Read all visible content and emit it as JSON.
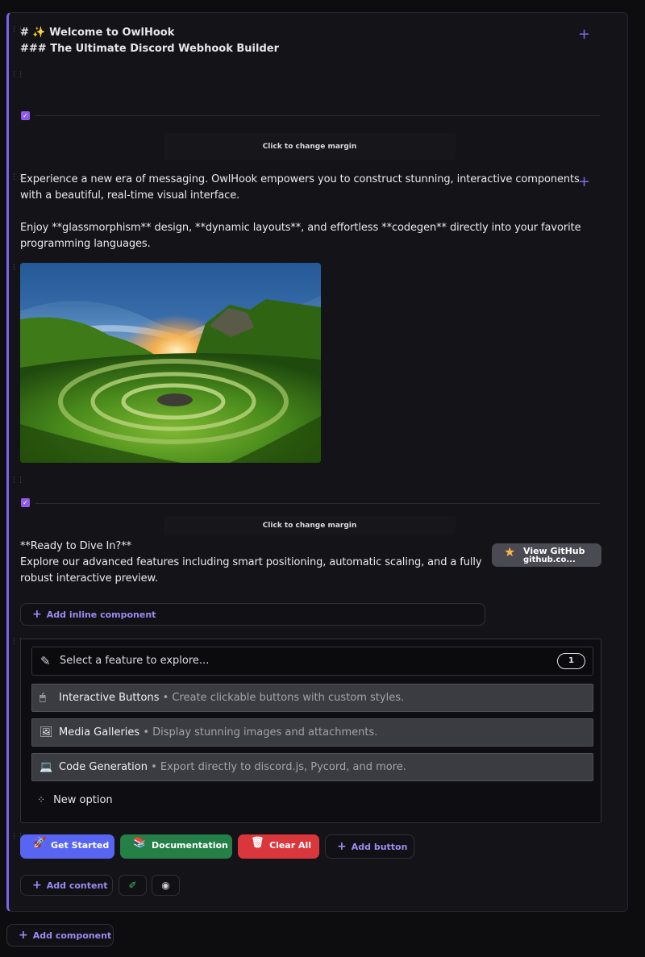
{
  "header": {
    "title": "# ✨ Welcome to OwlHook",
    "subtitle": "### The Ultimate Discord Webhook Builder"
  },
  "separator": {
    "margin_label": "Click to change margin"
  },
  "intro": {
    "line1": "Experience a new era of messaging. OwlHook empowers you to construct stunning, interactive components",
    "line2": "with a beautiful, real-time visual interface.",
    "line3": "Enjoy **glassmorphism** design, **dynamic layouts**, and effortless **codegen** directly into your favorite",
    "line4": "programming languages."
  },
  "cta": {
    "line1": "**Ready to Dive In?**",
    "line2": "Explore our advanced features including smart positioning, automatic scaling, and a fully",
    "line3": "robust interactive preview.",
    "github_label": "View GitHub",
    "github_url": "github.co..."
  },
  "inline_add_label": "Add inline component",
  "select_menu": {
    "placeholder": "Select a feature to explore...",
    "count": "1",
    "options": [
      {
        "icon": "mouse-icon",
        "label": "Interactive Buttons",
        "desc": "• Create clickable buttons with custom styles."
      },
      {
        "icon": "picture-icon",
        "label": "Media Galleries",
        "desc": "• Display stunning images and attachments."
      },
      {
        "icon": "laptop-icon",
        "label": "Code Generation",
        "desc": "• Export directly to discord.js, Pycord, and more."
      }
    ],
    "new_option_label": "New option"
  },
  "buttons": {
    "get_started": "Get Started",
    "documentation": "Documentation",
    "clear_all": "Clear All",
    "add_button": "Add button"
  },
  "add_content_label": "Add content",
  "add_component_label": "Add component",
  "colors": {
    "accent": "#7a63ee",
    "primary": "#5865f2",
    "success": "#248046",
    "danger": "#da373c",
    "secondary": "#4a4a52"
  }
}
